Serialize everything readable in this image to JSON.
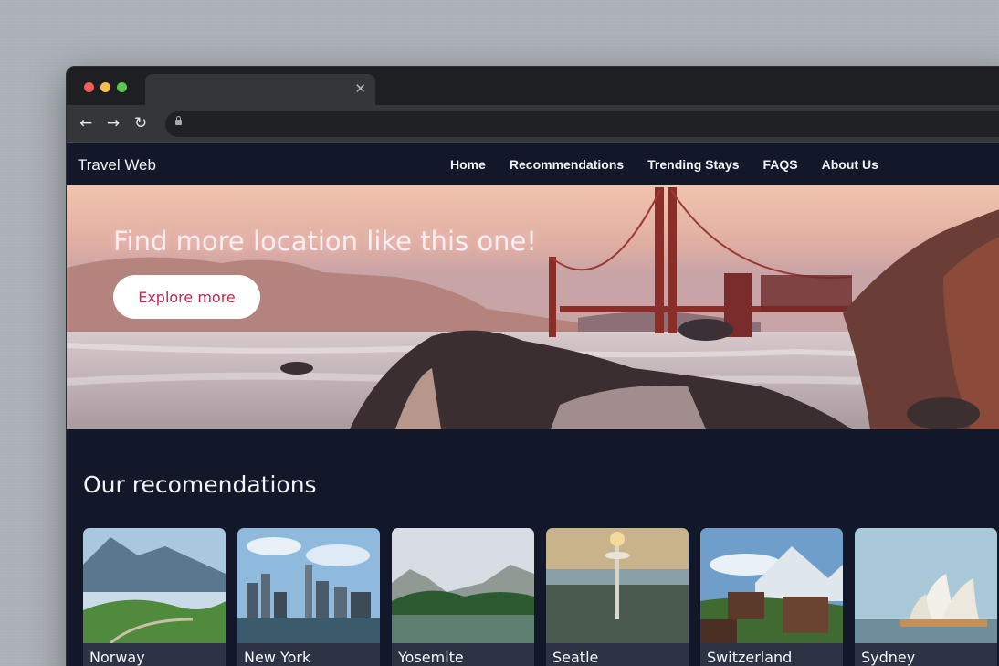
{
  "browser": {
    "tab_close_icon": "close-icon",
    "back_icon": "arrow-left-icon",
    "forward_icon": "arrow-right-icon",
    "reload_icon": "reload-icon"
  },
  "site": {
    "brand": "Travel Web",
    "nav": [
      "Home",
      "Recommendations",
      "Trending Stays",
      "FAQS",
      "About Us"
    ]
  },
  "hero": {
    "title": "Find more location like this one!",
    "button_label": "Explore more"
  },
  "recommendations": {
    "title": "Our recomendations",
    "cards": [
      "Norway",
      "New York",
      "Yosemite",
      "Seatle",
      "Switzerland",
      "Sydney"
    ]
  },
  "colors": {
    "page_bg": "#121829",
    "accent": "#c0264e",
    "card_bg": "#2b3344"
  }
}
